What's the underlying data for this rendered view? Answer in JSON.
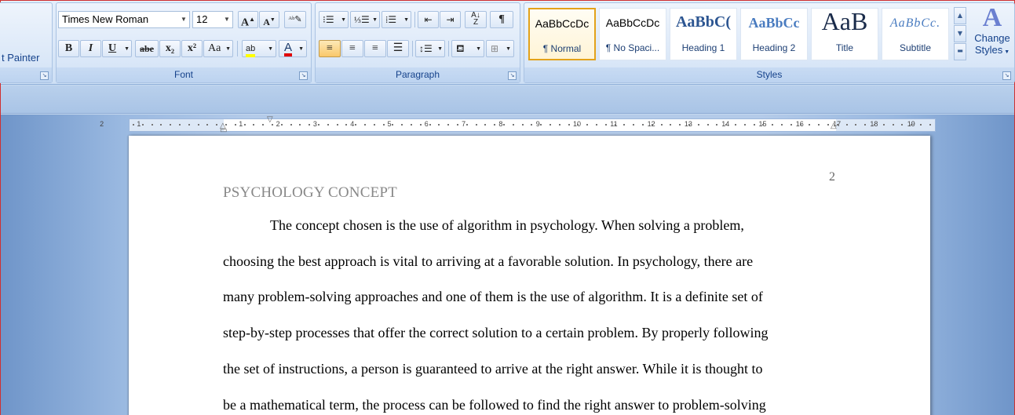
{
  "ribbon": {
    "clipboard": {
      "format_painter_label": "t Painter"
    },
    "font": {
      "group_label": "Font",
      "font_name": "Times New Roman",
      "font_size": "12",
      "grow_label": "A",
      "shrink_label": "A",
      "bold_label": "B",
      "italic_label": "I",
      "underline_label": "U",
      "strike_label": "abe",
      "subscript_label": "x₂",
      "superscript_label": "x²",
      "case_label": "Aa",
      "highlight_label": "ab",
      "font_color_label": "A",
      "highlight_color": "#ffff00",
      "font_color": "#e00000"
    },
    "paragraph": {
      "group_label": "Paragraph"
    },
    "styles": {
      "group_label": "Styles",
      "items": [
        {
          "sample": "AaBbCcDc",
          "name": "¶ Normal"
        },
        {
          "sample": "AaBbCcDc",
          "name": "¶ No Spaci..."
        },
        {
          "sample": "AaBbC(",
          "name": "Heading 1"
        },
        {
          "sample": "AaBbCc",
          "name": "Heading 2"
        },
        {
          "sample": "AaB",
          "name": "Title"
        },
        {
          "sample": "AaBbCc.",
          "name": "Subtitle"
        }
      ],
      "change_styles_line1": "Change",
      "change_styles_line2": "Styles"
    }
  },
  "ruler": {
    "labels": [
      "2",
      "1",
      "1",
      "2",
      "3",
      "4",
      "5",
      "6",
      "7",
      "8",
      "9",
      "10",
      "11",
      "12",
      "13",
      "14",
      "15",
      "16",
      "17",
      "18",
      "19"
    ]
  },
  "document": {
    "page_number": "2",
    "heading": "PSYCHOLOGY CONCEPT",
    "lines": [
      "The concept chosen is the use of algorithm in psychology. When solving a problem,",
      "choosing the best approach is vital to arriving at a favorable solution. In psychology, there are",
      "many problem-solving approaches and one of them is the use of algorithm. It is a definite set of",
      "step-by-step processes that offer the correct solution to a certain problem. By properly following",
      "the set of instructions, a person is guaranteed to arrive at the right answer. While it is thought to",
      "be a mathematical term, the process can be followed to find the right answer to problem-solving"
    ]
  }
}
